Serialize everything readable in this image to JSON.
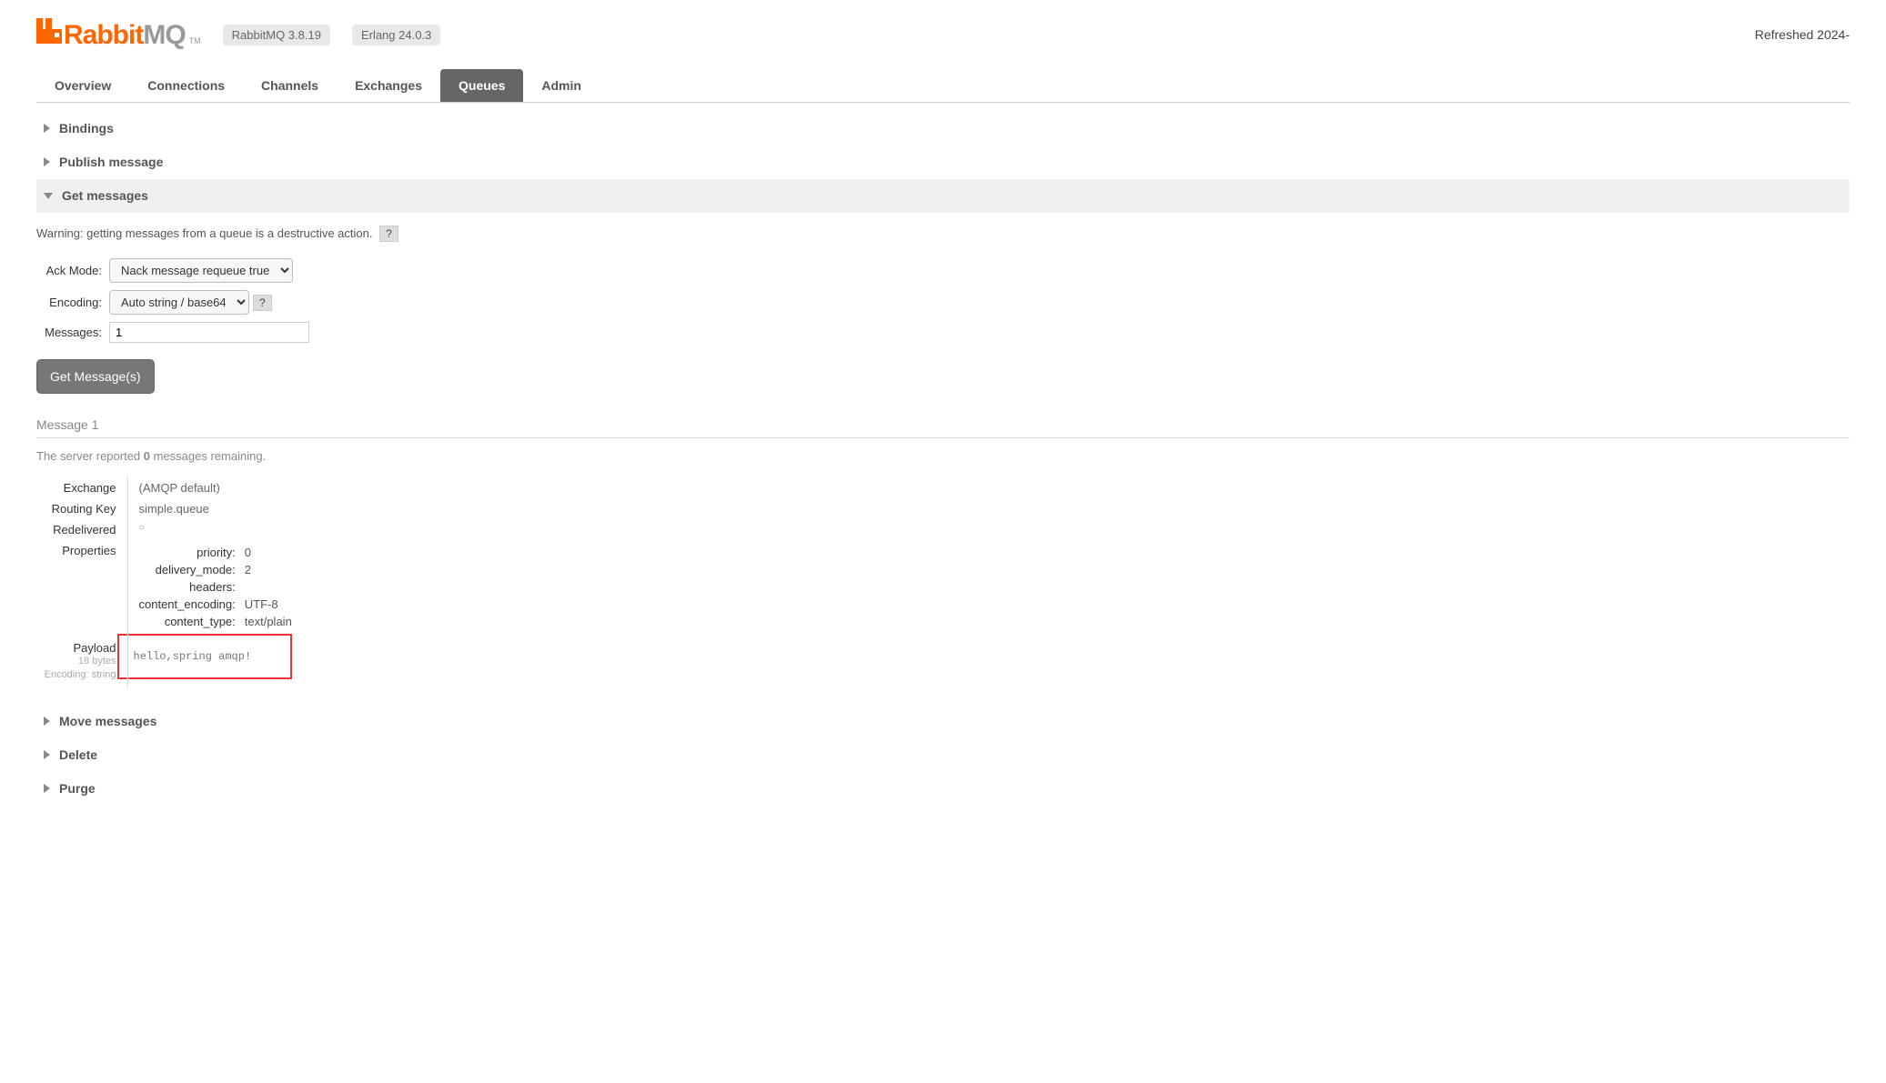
{
  "header": {
    "logo_rabbit": "Rabbit",
    "logo_mq": "MQ",
    "logo_tm": "TM",
    "rabbitmq_version": "RabbitMQ 3.8.19",
    "erlang_version": "Erlang 24.0.3",
    "refreshed": "Refreshed 2024-"
  },
  "tabs": {
    "overview": "Overview",
    "connections": "Connections",
    "channels": "Channels",
    "exchanges": "Exchanges",
    "queues": "Queues",
    "admin": "Admin"
  },
  "sections": {
    "bindings": "Bindings",
    "publish": "Publish message",
    "get_messages": "Get messages",
    "move": "Move messages",
    "delete": "Delete",
    "purge": "Purge"
  },
  "get_messages": {
    "warning": "Warning: getting messages from a queue is a destructive action.",
    "help": "?",
    "ack_mode_label": "Ack Mode:",
    "ack_mode_value": "Nack message requeue true",
    "encoding_label": "Encoding:",
    "encoding_value": "Auto string / base64",
    "messages_label": "Messages:",
    "messages_value": "1",
    "button": "Get Message(s)"
  },
  "result": {
    "heading": "Message 1",
    "remaining_prefix": "The server reported ",
    "remaining_count": "0",
    "remaining_suffix": " messages remaining.",
    "exchange_label": "Exchange",
    "exchange_value": "(AMQP default)",
    "routing_key_label": "Routing Key",
    "routing_key_value": "simple.queue",
    "redelivered_label": "Redelivered",
    "redelivered_value": "○",
    "properties_label": "Properties",
    "properties": {
      "priority_label": "priority:",
      "priority_value": "0",
      "delivery_mode_label": "delivery_mode:",
      "delivery_mode_value": "2",
      "headers_label": "headers:",
      "headers_value": "",
      "content_encoding_label": "content_encoding:",
      "content_encoding_value": "UTF-8",
      "content_type_label": "content_type:",
      "content_type_value": "text/plain"
    },
    "payload_label": "Payload",
    "payload_bytes": "18 bytes",
    "payload_encoding": "Encoding: string",
    "payload_value": "hello,spring amqp!"
  }
}
